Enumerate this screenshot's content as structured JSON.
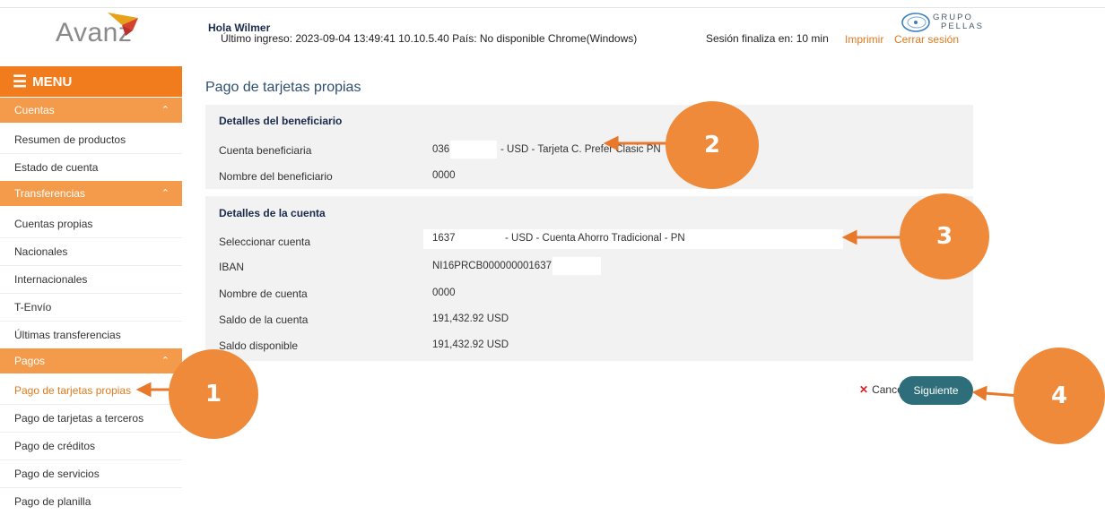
{
  "header": {
    "brand": "Avanz",
    "greeting": "Hola Wilmer",
    "last_login": "Último ingreso: 2023-09-04 13:49:41 10.10.5.40 País: No disponible Chrome(Windows)",
    "session": "Sesión finaliza en: 10 min",
    "print_link": "Imprimir",
    "logout_link": "Cerrar sesión",
    "group_logo_line1": "GRUPO",
    "group_logo_line2": "PELLAS"
  },
  "sidebar": {
    "menu_label": "MENU",
    "sections": [
      {
        "label": "Cuentas",
        "items": [
          "Resumen de productos",
          "Estado de cuenta"
        ]
      },
      {
        "label": "Transferencias",
        "items": [
          "Cuentas propias",
          "Nacionales",
          "Internacionales",
          "T-Envío",
          "Últimas transferencias"
        ]
      },
      {
        "label": "Pagos",
        "items": [
          "Pago de tarjetas propias",
          "Pago de tarjetas a terceros",
          "Pago de créditos",
          "Pago de servicios",
          "Pago de planilla"
        ]
      }
    ]
  },
  "main": {
    "title": "Pago de tarjetas propias",
    "beneficiary": {
      "heading": "Detalles del beneficiario",
      "account_label": "Cuenta beneficiaria",
      "account_value_prefix": "036",
      "account_value_suffix": "- USD - Tarjeta C. Prefer Clasic PN",
      "name_label": "Nombre del beneficiario",
      "name_value": "0000"
    },
    "account": {
      "heading": "Detalles de la cuenta",
      "select_label": "Seleccionar cuenta",
      "select_value_prefix": "1637",
      "select_value_suffix": "- USD - Cuenta Ahorro Tradicional - PN",
      "iban_label": "IBAN",
      "iban_value": "NI16PRCB000000001637",
      "name_label": "Nombre de cuenta",
      "name_value": "0000",
      "balance_label": "Saldo de la cuenta",
      "balance_value": "191,432.92 USD",
      "available_label": "Saldo disponible",
      "available_value": "191,432.92 USD"
    },
    "cancel_label": "Cancelar",
    "next_label": "Siguiente"
  },
  "callouts": [
    "1",
    "2",
    "3",
    "4"
  ],
  "colors": {
    "accent_orange": "#f07c1d",
    "section_orange": "#f39b4a",
    "callout": "#ee8a3a",
    "primary_button": "#2d6e7a"
  }
}
